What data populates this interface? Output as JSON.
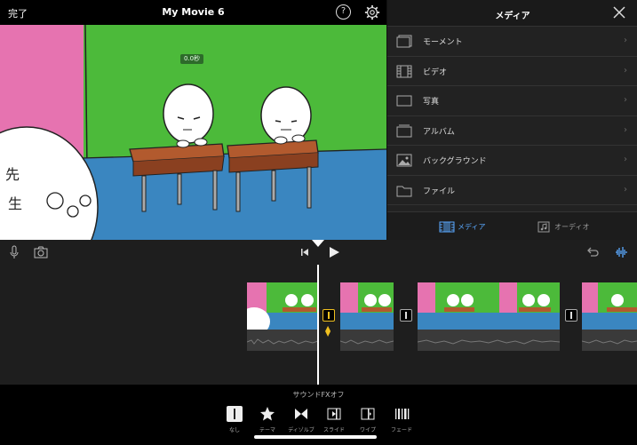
{
  "header": {
    "done_label": "完了",
    "title": "My Movie 6",
    "help_label": "?"
  },
  "viewer": {
    "time_badge": "0.0秒",
    "kanji_text": [
      "先",
      "生"
    ]
  },
  "media_panel": {
    "title": "メディア",
    "items": [
      {
        "label": "モーメント",
        "icon": "moments-icon"
      },
      {
        "label": "ビデオ",
        "icon": "film-icon"
      },
      {
        "label": "写真",
        "icon": "photo-icon"
      },
      {
        "label": "アルバム",
        "icon": "album-icon"
      },
      {
        "label": "バックグラウンド",
        "icon": "background-icon"
      },
      {
        "label": "ファイル",
        "icon": "folder-icon"
      }
    ],
    "tabs": [
      {
        "label": "メディア",
        "active": true
      },
      {
        "label": "オーディオ",
        "active": false
      }
    ]
  },
  "transitions": {
    "sound_fx_label": "サウンドFXオフ",
    "options": [
      {
        "label": "なし",
        "icon": "none-icon",
        "active": true
      },
      {
        "label": "テーマ",
        "icon": "star-icon",
        "active": false
      },
      {
        "label": "ディゾルブ",
        "icon": "dissolve-icon",
        "active": false
      },
      {
        "label": "スライド",
        "icon": "slide-icon",
        "active": false
      },
      {
        "label": "ワイプ",
        "icon": "wipe-icon",
        "active": false
      },
      {
        "label": "フェード",
        "icon": "fade-icon",
        "active": false
      }
    ]
  },
  "colors": {
    "accent": "#5aa9ff",
    "selection": "#f0c020",
    "scene_green": "#4cba3a",
    "scene_blue": "#3a86c0",
    "scene_pink": "#e673b0",
    "desk": "#b25a2e"
  }
}
